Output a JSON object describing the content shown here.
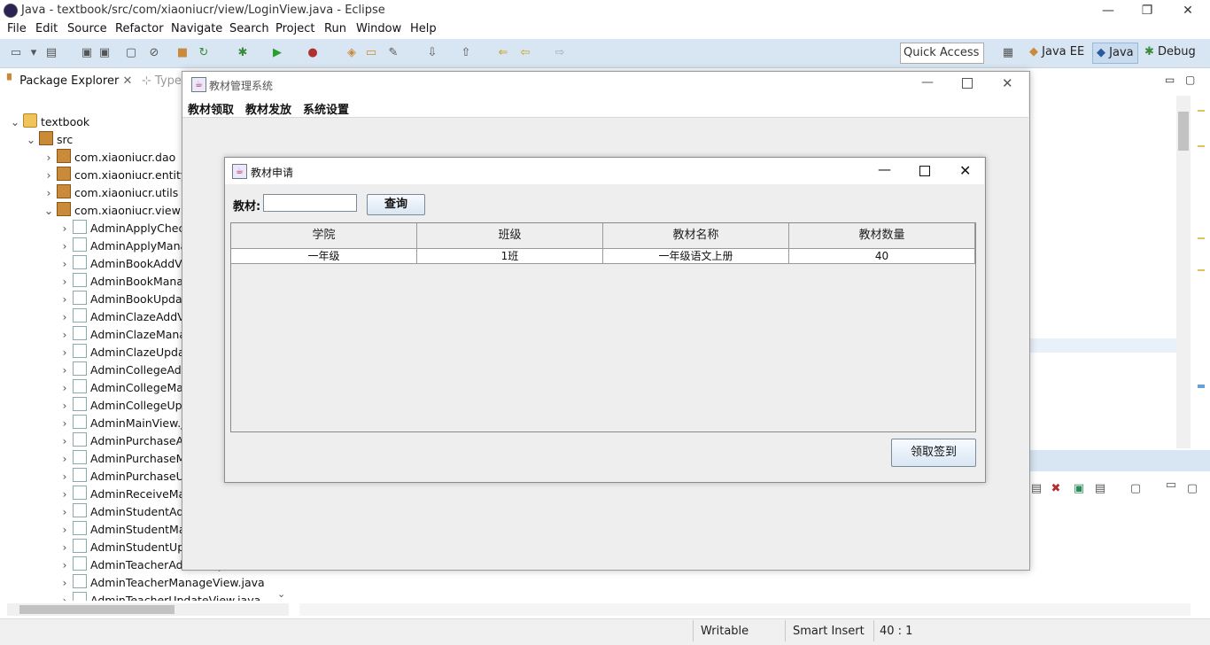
{
  "window": {
    "title": "Java - textbook/src/com/xiaoniucr/view/LoginView.java - Eclipse"
  },
  "menu": [
    "File",
    "Edit",
    "Source",
    "Refactor",
    "Navigate",
    "Search",
    "Project",
    "Run",
    "Window",
    "Help"
  ],
  "quick_access": "Quick Access",
  "perspectives": [
    "Java EE",
    "Java",
    "Debug"
  ],
  "package_explorer": {
    "tab_label": "Package Explorer",
    "second_tab": "Type",
    "project": "textbook",
    "src": "src",
    "packages": [
      "com.xiaoniucr.dao",
      "com.xiaoniucr.entity",
      "com.xiaoniucr.utils",
      "com.xiaoniucr.view"
    ],
    "files": [
      "AdminApplyChec",
      "AdminApplyMana",
      "AdminBookAddV",
      "AdminBookMana",
      "AdminBookUpda",
      "AdminClazeAddV",
      "AdminClazeMana",
      "AdminClazeUpda",
      "AdminCollegeAdc",
      "AdminCollegeMa",
      "AdminCollegeUpc",
      "AdminMainView.j",
      "AdminPurchaseAc",
      "AdminPurchaseM",
      "AdminPurchaseUp",
      "AdminReceiveMa",
      "AdminStudentAdc",
      "AdminStudentMa",
      "AdminStudentUpc",
      "AdminTeacherAddView.java",
      "AdminTeacherManageView.java",
      "AdminTeacherUpdateView.java"
    ]
  },
  "statusbar": {
    "writable": "Writable",
    "insert": "Smart Insert",
    "position": "40 : 1"
  },
  "app": {
    "title": "教材管理系统",
    "menu": [
      "教材领取",
      "教材发放",
      "系统设置"
    ]
  },
  "dialog": {
    "title": "教材申请",
    "search_label": "教材:",
    "search_value": "",
    "query_button": "查询",
    "table": {
      "columns": [
        "学院",
        "班级",
        "教材名称",
        "教材数量"
      ],
      "rows": [
        [
          "一年级",
          "1班",
          "一年级语文上册",
          "40"
        ]
      ]
    },
    "sign_button": "领取签到"
  }
}
